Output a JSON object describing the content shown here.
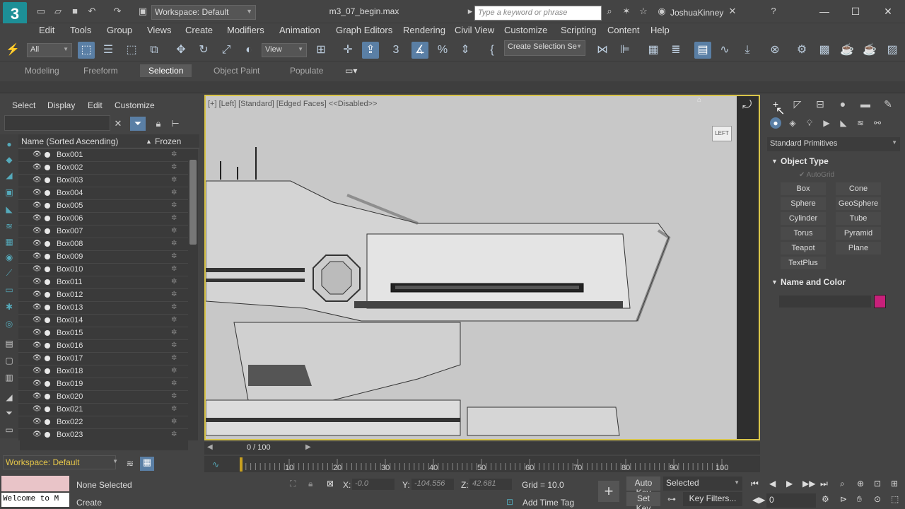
{
  "title_bar": {
    "logo": "3",
    "workspace": "Workspace: Default",
    "filename": "m3_07_begin.max",
    "search_placeholder": "Type a keyword or phrase",
    "username": "JoshuaKinney"
  },
  "menu": [
    "Edit",
    "Tools",
    "Group",
    "Views",
    "Create",
    "Modifiers",
    "Animation",
    "Graph Editors",
    "Rendering",
    "Civil View",
    "Customize",
    "Scripting",
    "Content",
    "Help"
  ],
  "toolbar": {
    "filter": "All",
    "coord_system": "View",
    "selection_set": "Create Selection Se"
  },
  "ribbon": {
    "tabs": [
      "Modeling",
      "Freeform",
      "Selection",
      "Object Paint",
      "Populate"
    ],
    "active": "Selection"
  },
  "explorer": {
    "menu": [
      "Select",
      "Display",
      "Edit",
      "Customize"
    ],
    "col_name": "Name (Sorted Ascending)",
    "col_frozen": "Frozen",
    "items": [
      "Box001",
      "Box002",
      "Box003",
      "Box004",
      "Box005",
      "Box006",
      "Box007",
      "Box008",
      "Box009",
      "Box010",
      "Box011",
      "Box012",
      "Box013",
      "Box014",
      "Box015",
      "Box016",
      "Box017",
      "Box018",
      "Box019",
      "Box020",
      "Box021",
      "Box022",
      "Box023"
    ],
    "workspace": "Workspace: Default"
  },
  "viewport": {
    "label": "[+] [Left] [Standard] [Edged Faces]  <<Disabled>>",
    "viewcube": "LEFT"
  },
  "timeline": {
    "time": "0 / 100",
    "ticks": [
      "10",
      "20",
      "30",
      "40",
      "50",
      "60",
      "70",
      "80",
      "90",
      "100"
    ]
  },
  "command_panel": {
    "category": "Standard Primitives",
    "object_type_title": "Object Type",
    "autogrid": "AutoGrid",
    "buttons": [
      "Box",
      "Cone",
      "Sphere",
      "GeoSphere",
      "Cylinder",
      "Tube",
      "Torus",
      "Pyramid",
      "Teapot",
      "Plane",
      "TextPlus"
    ],
    "name_color_title": "Name and Color",
    "swatch_color": "#c8207a"
  },
  "status": {
    "selection": "None Selected",
    "prompt": "Create",
    "maxscript": "Welcome to M",
    "x_label": "X:",
    "x_value": "-0.0",
    "y_label": "Y:",
    "y_value": "-104.556",
    "z_label": "Z:",
    "z_value": "42.681",
    "grid": "Grid = 10.0",
    "add_time_tag": "Add Time Tag",
    "auto_key": "Auto Key",
    "set_key": "Set Key",
    "key_mode": "Selected",
    "key_filters": "Key Filters...",
    "frame": "0"
  }
}
